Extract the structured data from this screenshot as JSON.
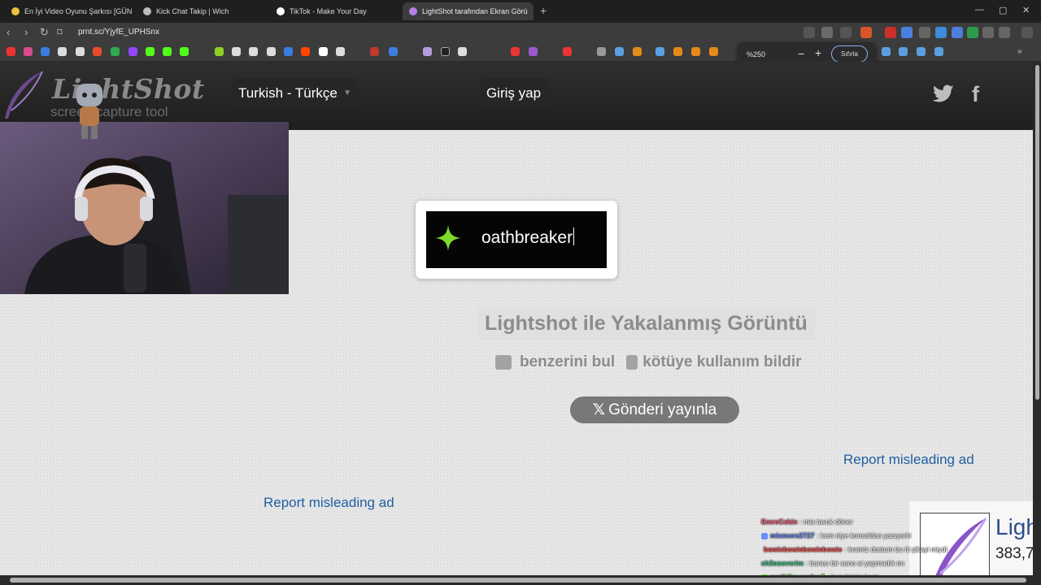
{
  "browser": {
    "tabs": [
      {
        "title": "En İyi Video Oyunu Şarkısı [GÜNCELL",
        "active": false,
        "favicon_color": "#e6c33a"
      },
      {
        "title": "Kick Chat Takip | Wich",
        "active": false,
        "favicon_color": "#bbbbbb"
      },
      {
        "title": "TikTok - Make Your Day",
        "active": false,
        "favicon_color": "#ffffff"
      },
      {
        "title": "LightShot tarafından Ekran Görü",
        "active": true,
        "favicon_color": "#b77ee6"
      }
    ],
    "new_tab_icon": "+",
    "window_controls": {
      "minimize": "—",
      "maximize": "▢",
      "close": "✕"
    },
    "url": "prnt.sc/YjyfE_UPHSnx",
    "zoom": {
      "value": "%250",
      "minus": "−",
      "plus": "+",
      "reset_label": "Sıfırla"
    }
  },
  "site": {
    "logo": "LightShot",
    "logo_subtitle": "screen capture tool",
    "language": "Turkish - Türkçe",
    "login": "Giriş yap",
    "social_icons": [
      "twitter-icon",
      "facebook-icon"
    ],
    "facebook_glyph": "f"
  },
  "screenshot": {
    "text": "oathbreaker",
    "icon": "sparkle-icon",
    "icon_color": "#7ddc2a"
  },
  "main": {
    "title": "Lightshot ile Yakalanmış Görüntü",
    "actions": [
      {
        "label": "benzerini bul",
        "icon": "camera-icon"
      },
      {
        "label": "kötüye kullanım bildir",
        "icon": "clipboard-icon"
      }
    ],
    "share_button": "Gönderi yayınla",
    "share_icon": "x-logo-icon",
    "report_ad_1": "Report misleading ad",
    "report_ad_2": "Report misleading ad"
  },
  "ad": {
    "title": "Ligh",
    "count": "383,7"
  },
  "chat": [
    {
      "user": "EmreCekin",
      "message": ": mia tavuk döner",
      "user_color": "#ff5a7a",
      "badge_color": ""
    },
    {
      "user": "mixmore2727",
      "message": ": kem niye konsoldan yazıyorki",
      "user_color": "#6a8cff",
      "badge_color": "#6a8cff"
    },
    {
      "user": "bowiebowiebowiebowie",
      "message": ": kramiz dostum bu iti şikayi miydi",
      "user_color": "#ff4f4f",
      "badge_color": "#cccccc"
    },
    {
      "user": "ch3oseverim",
      "message": ": burası bir suno ai yapmadık mı",
      "user_color": "#3ecf8e",
      "badge_color": ""
    },
    {
      "user": "nuribilgeceylan2",
      "message": ": ben kimim beat",
      "user_color": "#53fc18",
      "badge_color": "#53fc18"
    }
  ]
}
